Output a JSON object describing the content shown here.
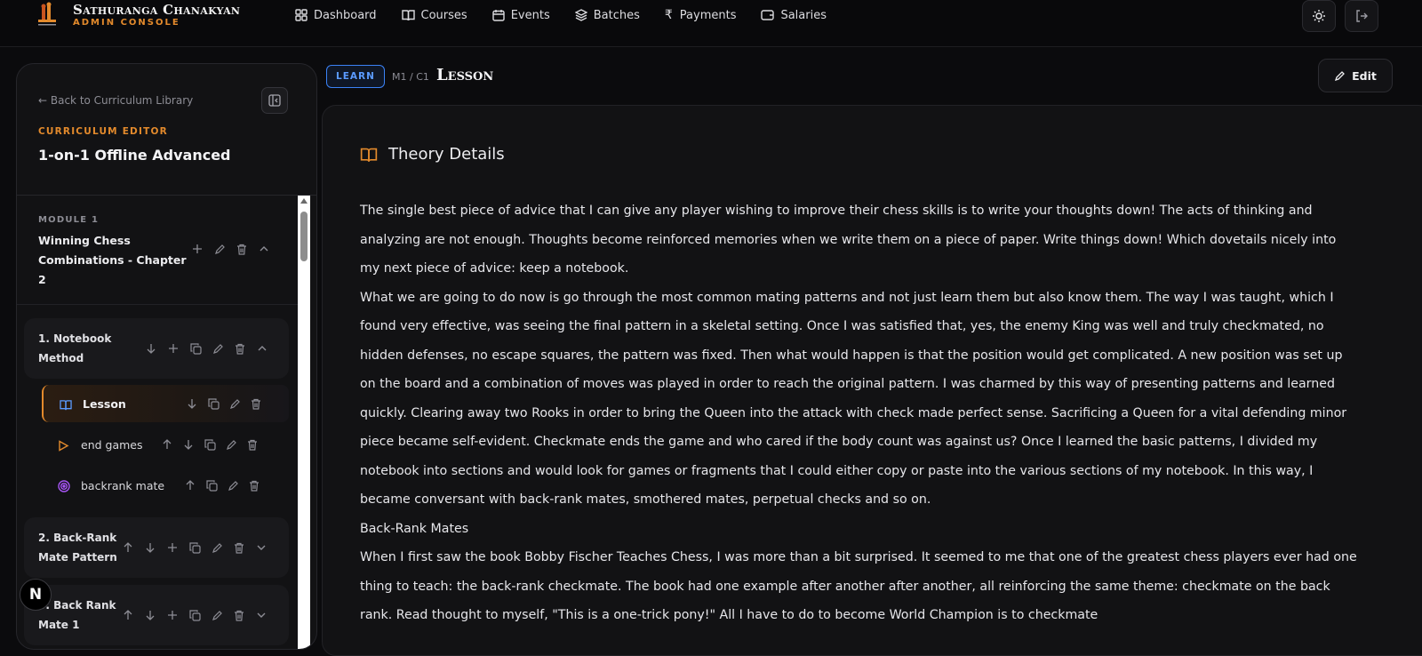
{
  "brand": {
    "title": "Sathuranga Chanakyan",
    "subtitle": "ADMIN CONSOLE",
    "logo_icon": "chess-logo-icon"
  },
  "nav": [
    {
      "label": "Dashboard",
      "icon": "grid-icon"
    },
    {
      "label": "Courses",
      "icon": "book-icon"
    },
    {
      "label": "Events",
      "icon": "calendar-icon"
    },
    {
      "label": "Batches",
      "icon": "layers-icon"
    },
    {
      "label": "Payments",
      "icon": "rupee-icon"
    },
    {
      "label": "Salaries",
      "icon": "wallet-icon"
    }
  ],
  "top_actions": {
    "theme_icon": "sun-icon",
    "logout_icon": "logout-icon"
  },
  "sidebar": {
    "back_label": "← Back to Curriculum Library",
    "editor_label": "CURRICULUM EDITOR",
    "course_title": "1-on-1 Offline Advanced",
    "module": {
      "label": "MODULE 1",
      "title": "Winning Chess Combinations - Chapter 2"
    },
    "chapters": [
      {
        "title": "1. Notebook Method",
        "expanded": true,
        "lessons": [
          {
            "label": "Lesson",
            "type": "book-icon",
            "active": true
          },
          {
            "label": "end games",
            "type": "play-icon",
            "active": false
          },
          {
            "label": "backrank mate",
            "type": "target-icon",
            "active": false
          }
        ]
      },
      {
        "title": "2. Back-Rank Mate Pattern",
        "expanded": false
      },
      {
        "title": "3. Back Rank Mate 1",
        "expanded": false
      }
    ]
  },
  "badge_n": "N",
  "main": {
    "tag": "LEARN",
    "breadcrumb": "M1 / C1",
    "heading": "Lesson",
    "edit_label": "Edit",
    "theory_title": "Theory Details",
    "paragraphs": [
      "The single best piece of advice that I can give any player wishing to improve their chess skills is to write your thoughts down! The acts of thinking and analyzing are not enough. Thoughts become reinforced memories when we write them on a piece of paper. Write things down! Which dovetails nicely into my next piece of advice: keep a notebook.",
      "What we are going to do now is go through the most common mating patterns and not just learn them but also know them. The way I was taught, which I found very effective, was seeing the final pattern in a skeletal setting. Once I was satisfied that, yes, the enemy King was well and truly checkmated, no hidden defenses, no escape squares, the pattern was fixed. Then what would happen is that the position would get complicated. A new position was set up on the board and a combination of moves was played in order to reach the original pattern. I was charmed by this way of presenting patterns and learned quickly. Clearing away two Rooks in order to bring the Queen into the attack with check made perfect sense. Sacrificing a Queen for a vital defending minor piece became self-evident. Checkmate ends the game and who cared if the body count was against us? Once I learned the basic patterns, I divided my notebook into sections and would look for games or fragments that I could either copy or paste into the various sections of my notebook. In this way, I became conversant with back-rank mates, smothered mates, perpetual checks and so on.",
      "Back-Rank Mates",
      "When I first saw the book Bobby Fischer Teaches Chess, I was more than a bit surprised. It seemed to me that one of the greatest chess players ever had one thing to teach: the back-rank checkmate. The book had one example after another after another, all reinforcing the same theme: checkmate on the back rank. Read thought to myself, \"This is a one-trick pony!\" All I have to do to become World Champion is to checkmate"
    ]
  },
  "colors": {
    "accent": "#e38a2c",
    "learn_blue": "#3b82f6",
    "target_purple": "#a855f7"
  }
}
